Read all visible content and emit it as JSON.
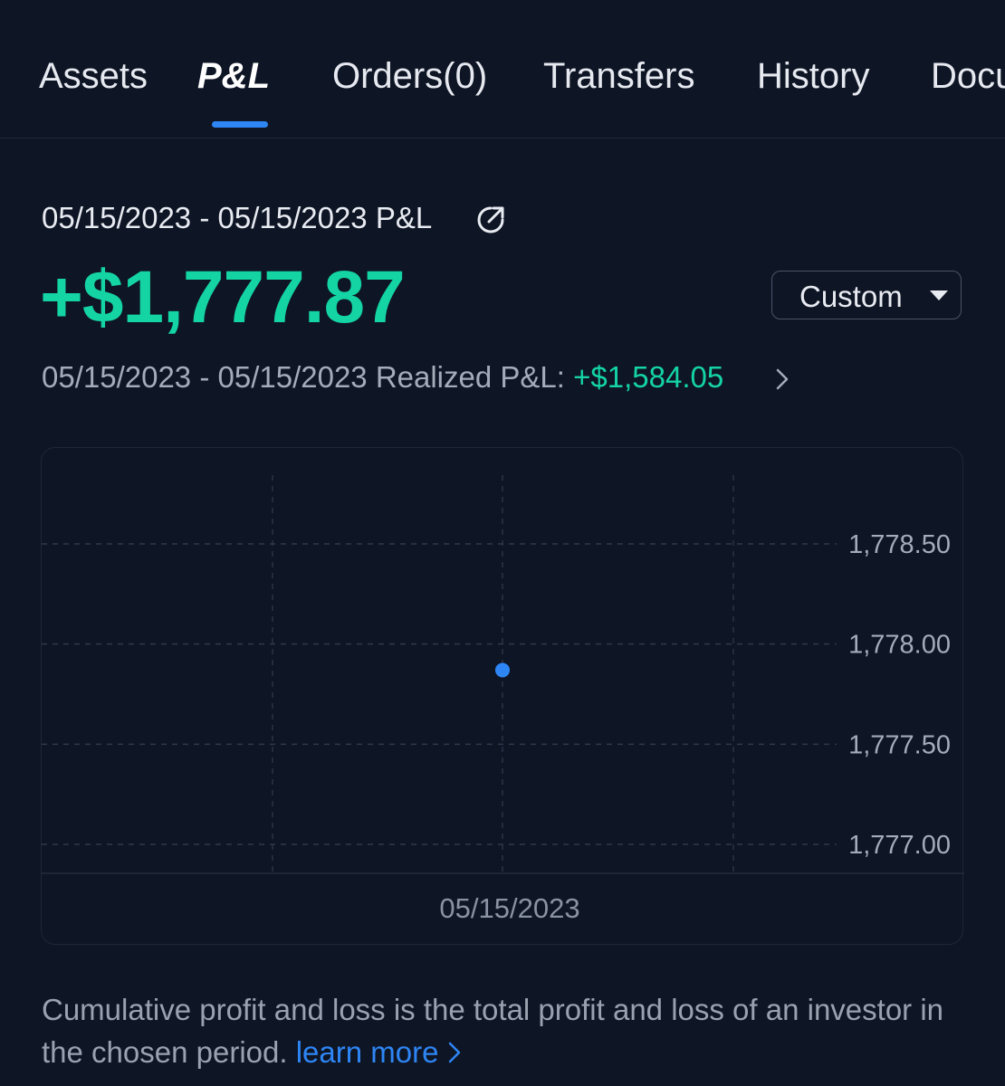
{
  "tabs": [
    {
      "label": "Assets",
      "active": false
    },
    {
      "label": "P&L",
      "active": true
    },
    {
      "label": "Orders(0)",
      "active": false
    },
    {
      "label": "Transfers",
      "active": false
    },
    {
      "label": "History",
      "active": false
    },
    {
      "label": "Documents",
      "active": false
    }
  ],
  "summary": {
    "period_title": "05/15/2023 - 05/15/2023 P&L",
    "total_pl": "+$1,777.87",
    "range_select": "Custom",
    "realized_prefix": "05/15/2023 - 05/15/2023 Realized P&L: ",
    "realized_value": "+$1,584.05"
  },
  "chart_data": {
    "type": "line",
    "x": [
      "05/15/2023"
    ],
    "series": [
      {
        "values": [
          1777.87
        ]
      }
    ],
    "y_ticks": [
      "1,778.50",
      "1,778.00",
      "1,777.50",
      "1,777.00"
    ],
    "ylim": [
      1777.0,
      1778.5
    ],
    "grid": true,
    "point_color": "#2e86f5"
  },
  "footnote": {
    "text": "Cumulative profit and loss is the total profit and loss of an investor in the chosen period. ",
    "link": "learn more"
  },
  "colors": {
    "background": "#0e1525",
    "profit": "#14d4a4",
    "accent": "#2e86f5"
  },
  "icons": {
    "share": "share-icon",
    "dropdown": "chevron-down-icon",
    "chevron": "chevron-right-icon"
  }
}
